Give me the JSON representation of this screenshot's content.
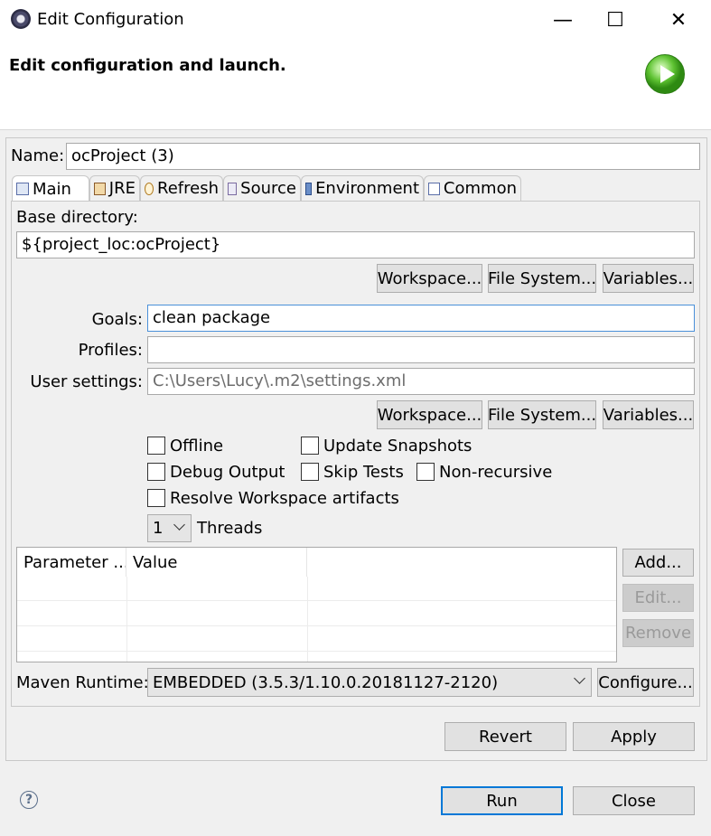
{
  "window": {
    "title": "Edit Configuration",
    "minimize": "—",
    "maximize": "☐",
    "close": "✕"
  },
  "header": {
    "title": "Edit configuration and launch."
  },
  "name": {
    "label": "Name:",
    "value": "ocProject (3)"
  },
  "tabs": [
    {
      "label": "Main",
      "icon": "main-tab-icon"
    },
    {
      "label": "JRE",
      "icon": "jre-icon"
    },
    {
      "label": "Refresh",
      "icon": "refresh-icon"
    },
    {
      "label": "Source",
      "icon": "source-icon"
    },
    {
      "label": "Environment",
      "icon": "environment-icon"
    },
    {
      "label": "Common",
      "icon": "common-icon"
    }
  ],
  "main": {
    "base_dir_label": "Base directory:",
    "base_dir_value": "${project_loc:ocProject}",
    "base_buttons": {
      "workspace": "Workspace...",
      "file_system": "File System...",
      "variables": "Variables..."
    },
    "goals_label": "Goals:",
    "goals_value": "clean package",
    "profiles_label": "Profiles:",
    "profiles_value": "",
    "user_settings_label": "User settings:",
    "user_settings_value": "C:\\Users\\Lucy\\.m2\\settings.xml",
    "settings_buttons": {
      "workspace": "Workspace...",
      "file_system": "File System...",
      "variables": "Variables..."
    },
    "checkboxes": {
      "offline": "Offline",
      "update_snapshots": "Update Snapshots",
      "debug_output": "Debug Output",
      "skip_tests": "Skip Tests",
      "non_recursive": "Non-recursive",
      "resolve_workspace": "Resolve Workspace artifacts"
    },
    "threads_value": "1",
    "threads_label": "Threads",
    "table": {
      "col_param": "Parameter ...",
      "col_value": "Value"
    },
    "table_buttons": {
      "add": "Add...",
      "edit": "Edit...",
      "remove": "Remove"
    },
    "runtime_label": "Maven Runtime:",
    "runtime_value": "EMBEDDED (3.5.3/1.10.0.20181127-2120)",
    "configure": "Configure..."
  },
  "footer": {
    "revert": "Revert",
    "apply": "Apply",
    "run": "Run",
    "close": "Close",
    "help": "?"
  }
}
